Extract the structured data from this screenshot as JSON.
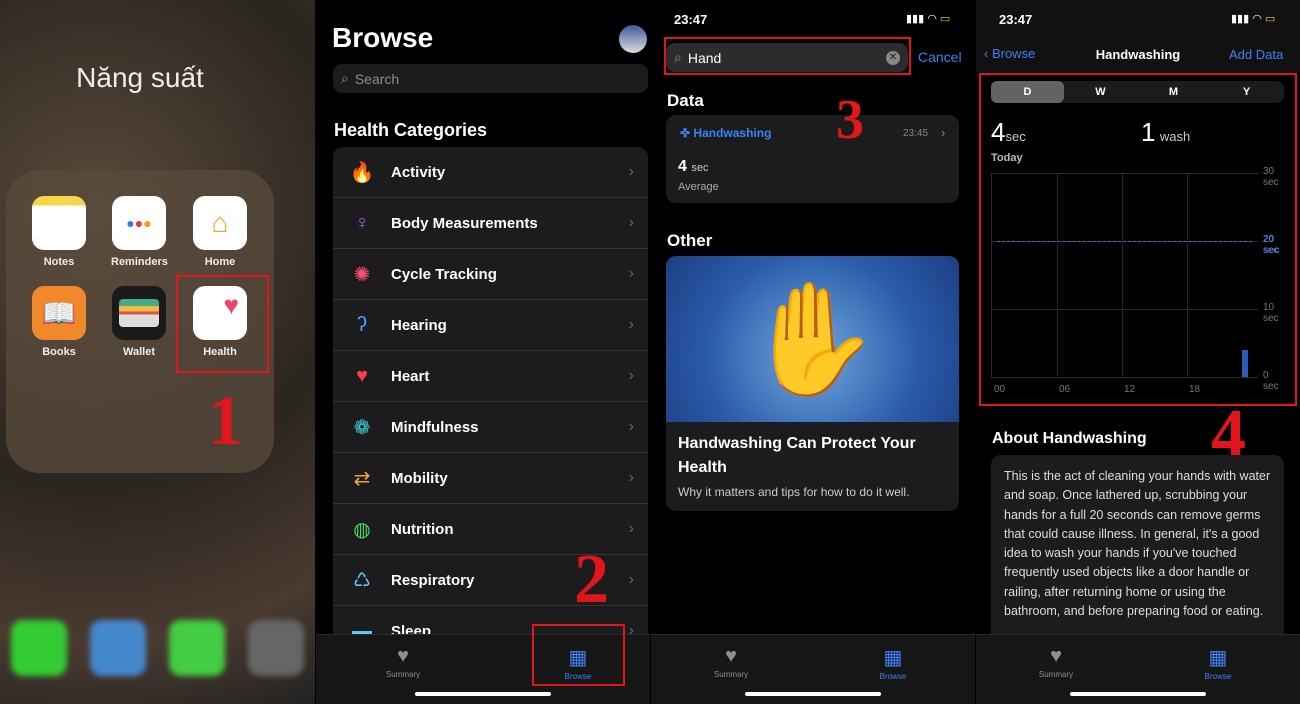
{
  "annotations": [
    "1",
    "2",
    "3",
    "4"
  ],
  "colors": {
    "accent": "#3b82f6",
    "annotation": "#e0161c",
    "card": "#1c1c1e"
  },
  "panel1": {
    "folder_title": "Năng suất",
    "apps": [
      {
        "label": "Notes",
        "icon": "notes-icon"
      },
      {
        "label": "Reminders",
        "icon": "reminders-icon"
      },
      {
        "label": "Home",
        "icon": "home-icon"
      },
      {
        "label": "Books",
        "icon": "books-icon"
      },
      {
        "label": "Wallet",
        "icon": "wallet-icon"
      },
      {
        "label": "Health",
        "icon": "heart-icon"
      }
    ]
  },
  "panel2": {
    "title": "Browse",
    "search_placeholder": "Search",
    "section": "Health Categories",
    "categories": [
      {
        "label": "Activity",
        "icon": "flame-icon",
        "color": "#ff6b1a"
      },
      {
        "label": "Body Measurements",
        "icon": "figure-icon",
        "color": "#b05cf0"
      },
      {
        "label": "Cycle Tracking",
        "icon": "cycle-icon",
        "color": "#ff4d6d"
      },
      {
        "label": "Hearing",
        "icon": "ear-icon",
        "color": "#4aa3ff"
      },
      {
        "label": "Heart",
        "icon": "heart-icon",
        "color": "#ff3b4e"
      },
      {
        "label": "Mindfulness",
        "icon": "flower-icon",
        "color": "#38d2d6"
      },
      {
        "label": "Mobility",
        "icon": "arrows-icon",
        "color": "#f5a623"
      },
      {
        "label": "Nutrition",
        "icon": "apple-icon",
        "color": "#4cd964"
      },
      {
        "label": "Respiratory",
        "icon": "lungs-icon",
        "color": "#5ac8fa"
      },
      {
        "label": "Sleep",
        "icon": "bed-icon",
        "color": "#5ac8fa"
      }
    ],
    "tabs": {
      "summary": "Summary",
      "browse": "Browse"
    }
  },
  "panel3": {
    "time": "23:47",
    "search_value": "Hand",
    "cancel": "Cancel",
    "data_heading": "Data",
    "result": {
      "name": "Handwashing",
      "time": "23:45",
      "value": "4",
      "unit": "sec",
      "label": "Average"
    },
    "other_heading": "Other",
    "article": {
      "title": "Handwashing Can Protect Your Health",
      "subtitle": "Why it matters and tips for how to do it well."
    },
    "tabs": {
      "summary": "Summary",
      "browse": "Browse"
    }
  },
  "panel4": {
    "time": "23:47",
    "back": "Browse",
    "title": "Handwashing",
    "add": "Add Data",
    "segments": [
      "D",
      "W",
      "M",
      "Y"
    ],
    "selected_segment": "D",
    "avg_value": "4",
    "avg_unit": "sec",
    "count_value": "1",
    "count_unit": "wash",
    "period": "Today",
    "about_heading": "About Handwashing",
    "about_text": "This is the act of cleaning your hands with water and soap. Once lathered up, scrubbing your hands for a full 20 seconds can remove germs that could cause illness. In general, it's a good idea to wash your hands if you've touched frequently used objects like a door handle or railing, after returning home or using the bathroom, and before preparing food or eating.",
    "tabs": {
      "summary": "Summary",
      "browse": "Browse"
    }
  },
  "chart_data": {
    "type": "bar",
    "x_ticks": [
      "00",
      "06",
      "12",
      "18"
    ],
    "y_ticks": [
      "0 sec",
      "10 sec",
      "20 sec",
      "30 sec"
    ],
    "ylim": [
      0,
      30
    ],
    "goal_line": {
      "value": 20,
      "label": "20 sec"
    },
    "points": [
      {
        "hour": 23,
        "value": 4
      }
    ]
  }
}
